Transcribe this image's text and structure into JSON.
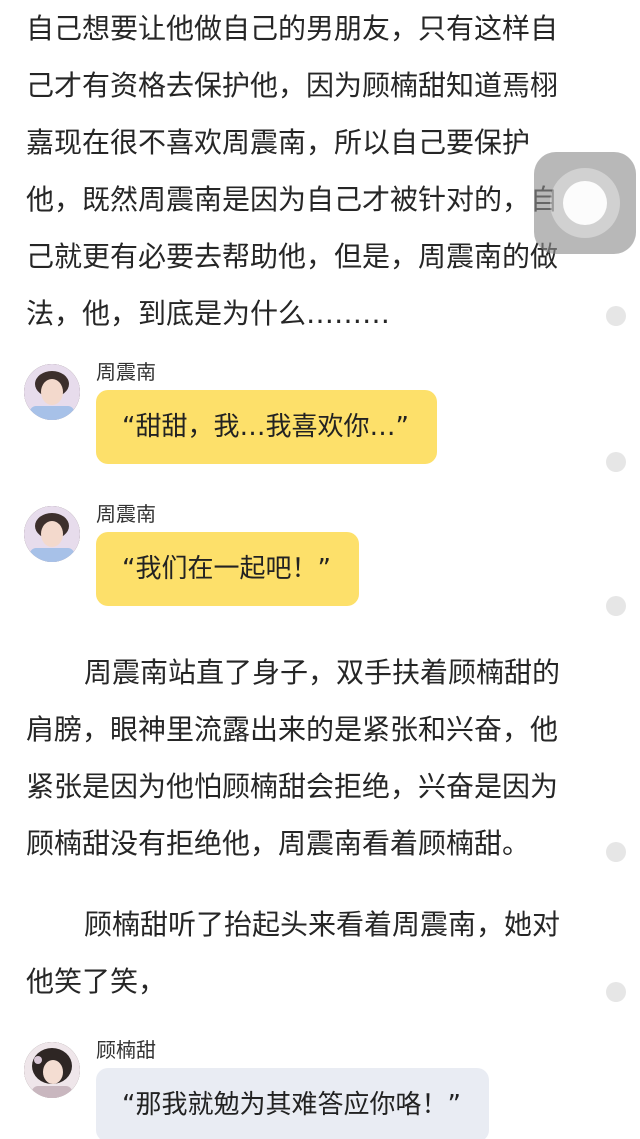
{
  "paragraphs": [
    {
      "lines": [
        "自己想要让他做自己的男朋友，只有这样自",
        "己才有资格去保护他，因为顾楠甜知道焉栩",
        "嘉现在很不喜欢周震南，所以自己要保护",
        "他，既然周震南是因为自己才被针对的，自",
        "己就更有必要去帮助他，但是，周震南的做",
        "法，他，到底是为什么………"
      ]
    },
    {
      "lines": [
        "周震南站直了身子，双手扶着顾楠甜的",
        "肩膀，眼神里流露出来的是紧张和兴奋，他",
        "紧张是因为他怕顾楠甜会拒绝，兴奋是因为",
        "顾楠甜没有拒绝他，周震南看着顾楠甜。"
      ]
    },
    {
      "lines": [
        "顾楠甜听了抬起头来看着周震南，她对",
        "他笑了笑，"
      ]
    }
  ],
  "messages": [
    {
      "sender": "周震南",
      "text": "“甜甜，我…我喜欢你…”",
      "bubble_color": "#fde06a"
    },
    {
      "sender": "周震南",
      "text": "“我们在一起吧！”",
      "bubble_color": "#fde06a"
    },
    {
      "sender": "顾楠甜",
      "text": "“那我就勉为其难答应你咯！”",
      "bubble_color": "#e9ecf3"
    }
  ],
  "icons": {
    "float_button": "assistive-touch-icon",
    "avatar": "avatar-photo",
    "scroll_marker": "dot-icon"
  }
}
